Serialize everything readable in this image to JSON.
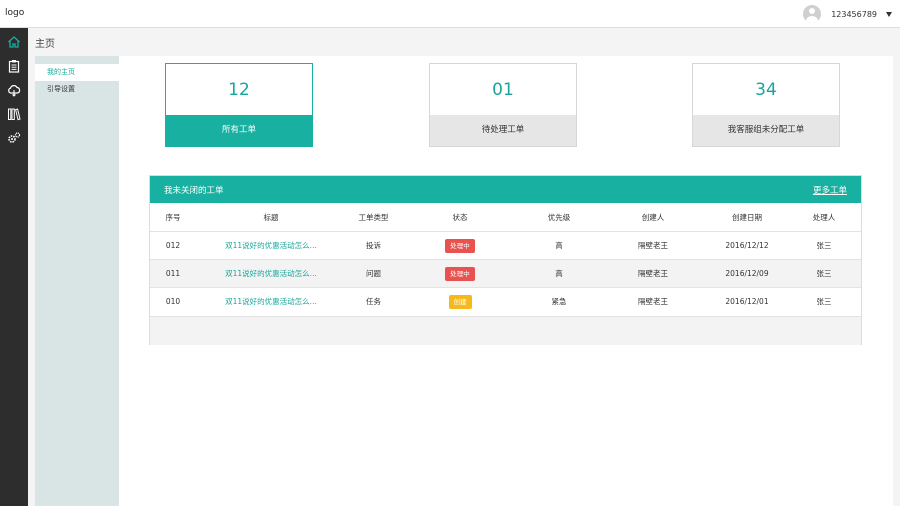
{
  "header": {
    "logo": "logo",
    "username": "123456789"
  },
  "breadcrumb": "主页",
  "subnav": [
    {
      "label": "我的主页",
      "active": true
    },
    {
      "label": "引导设置",
      "active": false
    }
  ],
  "stats": [
    {
      "value": "12",
      "label": "所有工单"
    },
    {
      "value": "01",
      "label": "待处理工单"
    },
    {
      "value": "34",
      "label": "我客服组未分配工单"
    }
  ],
  "panel": {
    "title": "我未关闭的工单",
    "more": "更多工单",
    "columns": [
      "序号",
      "标题",
      "工单类型",
      "状态",
      "优先级",
      "创建人",
      "创建日期",
      "处理人"
    ],
    "rows": [
      {
        "id": "012",
        "title": "双11说好的优惠活动怎么...",
        "type": "投诉",
        "status": "处理中",
        "priority": "高",
        "creator": "隔壁老王",
        "date": "2016/12/12",
        "handler": "张三"
      },
      {
        "id": "011",
        "title": "双11说好的优惠活动怎么...",
        "type": "问题",
        "status": "处理中",
        "priority": "高",
        "creator": "隔壁老王",
        "date": "2016/12/09",
        "handler": "张三"
      },
      {
        "id": "010",
        "title": "双11说好的优惠活动怎么...",
        "type": "任务",
        "status": "创建",
        "priority": "紧急",
        "creator": "隔壁老王",
        "date": "2016/12/01",
        "handler": "张三"
      }
    ]
  },
  "colors": {
    "accent": "#18b0a0",
    "status_processing": "#e8534f",
    "status_created": "#f6b91b",
    "sidebar": "#2d2d2d"
  },
  "icons": [
    "home-icon",
    "clipboard-icon",
    "cloud-icon",
    "books-icon",
    "gears-icon"
  ]
}
